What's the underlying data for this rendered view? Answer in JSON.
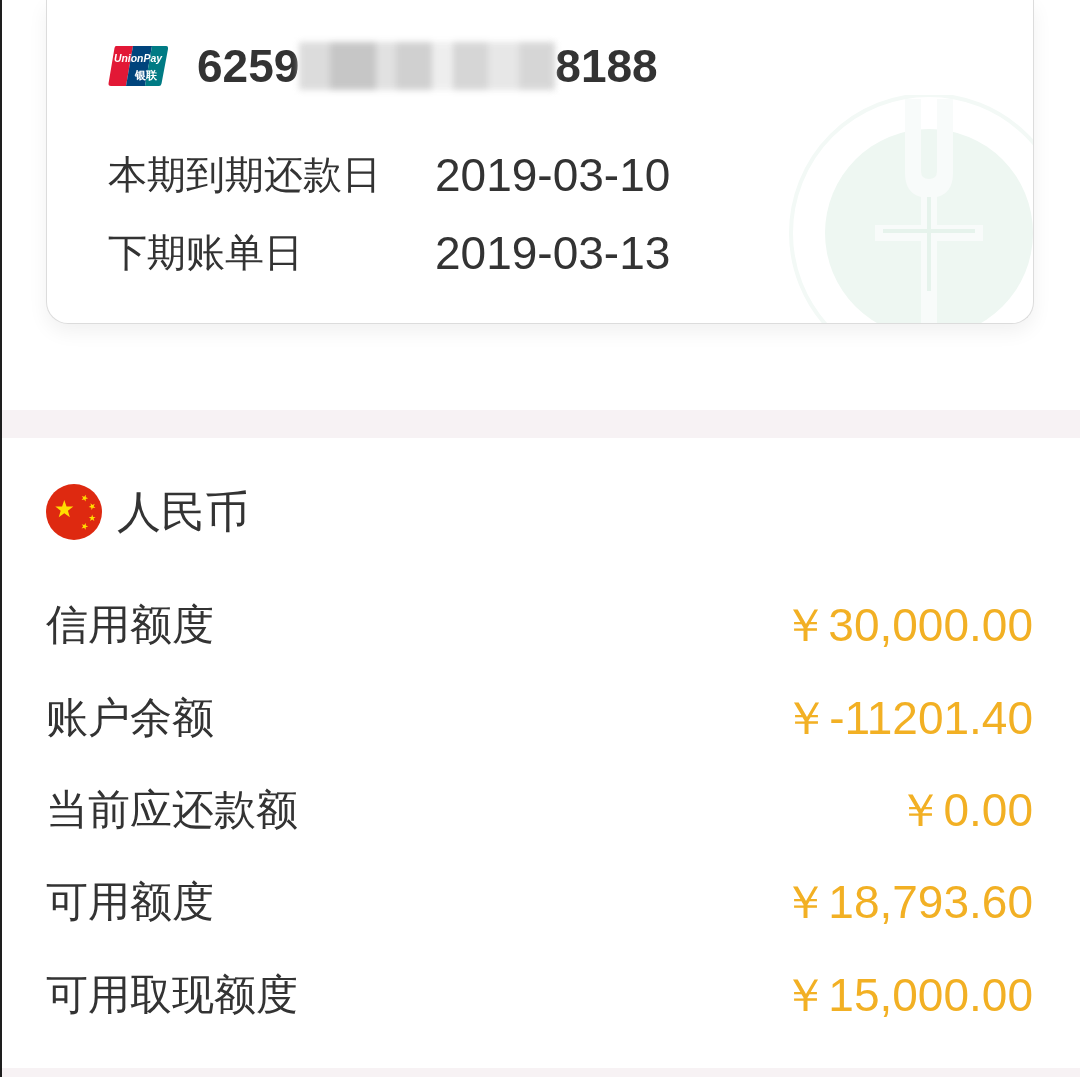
{
  "card": {
    "network_logo": {
      "text_top": "UnionPay",
      "text_bottom": "银联"
    },
    "card_number": {
      "first_digits": "6259",
      "masked": true,
      "last_digits": "8188"
    },
    "dates": [
      {
        "label": "本期到期还款日",
        "value": "2019-03-10"
      },
      {
        "label": "下期账单日",
        "value": "2019-03-13"
      }
    ]
  },
  "currency": {
    "name": "人民币"
  },
  "amounts": [
    {
      "label": "信用额度",
      "value": "￥30,000.00"
    },
    {
      "label": "账户余额",
      "value": "￥-11201.40"
    },
    {
      "label": "当前应还款额",
      "value": "￥0.00"
    },
    {
      "label": "可用额度",
      "value": "￥18,793.60"
    },
    {
      "label": "可用取现额度",
      "value": "￥15,000.00"
    }
  ]
}
